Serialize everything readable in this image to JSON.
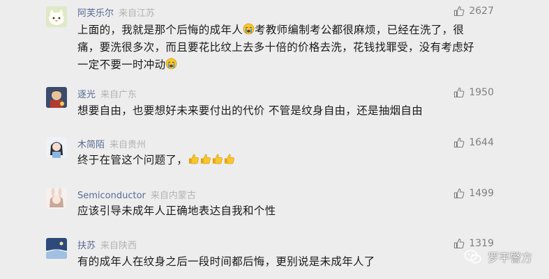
{
  "comments": [
    {
      "username": "阿芙乐尔",
      "location": "来自江苏",
      "likes": "2627",
      "lines": [
        [
          "上面的，我就是那个后悔的成年人",
          "考教师编制考公都很麻烦，已经在洗了，很"
        ],
        [
          "痛，要洗很多次，而且要花比纹上去多十倍的价格去洗，花钱找罪受，没有考虑好"
        ],
        [
          "一定不要一时冲动",
          ""
        ]
      ]
    },
    {
      "username": "逐光",
      "location": "来自广东",
      "likes": "1950",
      "text": "想要自由，也要想好未来要付出的代价 不管是纹身自由，还是抽烟自由"
    },
    {
      "username": "木简陌",
      "location": "来自贵州",
      "likes": "1644",
      "text": "终于在管这个问题了，"
    },
    {
      "username": "Semiconductor",
      "location": "来自内蒙古",
      "likes": "1499",
      "text": "应该引导未成年人正确地表达自我和个性"
    },
    {
      "username": "扶苏",
      "location": "来自陕西",
      "likes": "1319",
      "text": "有的成年人在纹身之后一段时间都后悔，更别说是未成年人了"
    }
  ],
  "watermark": {
    "text": "罗平警方"
  },
  "colors": {
    "background": "#ededed",
    "username": "#576b95",
    "location": "#b2b2b2",
    "likes": "#7f7f7f",
    "body_text": "#1a1a1a"
  },
  "icons": {
    "like": "thumb-up-icon",
    "crying_emoji": "crying-face-emoji",
    "thumbs_up_emoji": "thumbs-up-emoji",
    "watermark_logo": "wechat-official-account-icon"
  }
}
